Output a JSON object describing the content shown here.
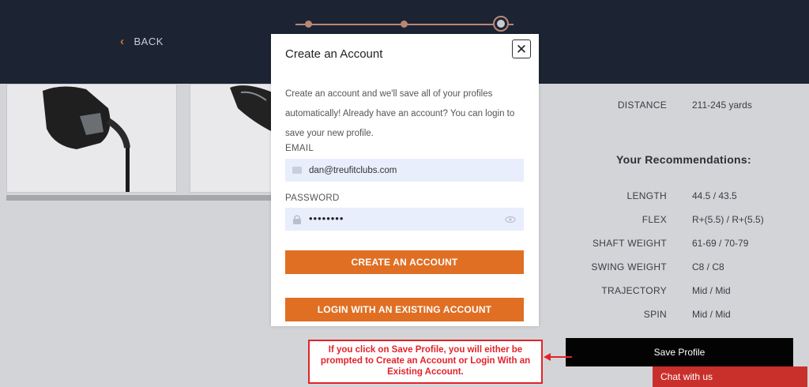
{
  "header": {
    "back_label": "BACK",
    "stepper_current": 3,
    "stepper_total": 3
  },
  "stats": {
    "distance_label": "DISTANCE",
    "distance_value": "211-245 yards",
    "recommendations_title": "Your Recommendations:",
    "rows": [
      {
        "label": "LENGTH",
        "value": "44.5 / 43.5"
      },
      {
        "label": "FLEX",
        "value": "R+(5.5) / R+(5.5)"
      },
      {
        "label": "SHAFT WEIGHT",
        "value": "61-69 / 70-79"
      },
      {
        "label": "SWING WEIGHT",
        "value": "C8 / C8"
      },
      {
        "label": "TRAJECTORY",
        "value": "Mid / Mid"
      },
      {
        "label": "SPIN",
        "value": "Mid / Mid"
      }
    ]
  },
  "save_profile_label": "Save Profile",
  "chat_label": "Chat with us",
  "modal": {
    "title": "Create an Account",
    "description": "Create an account and we'll save all of your profiles automatically! Already have an account? You can login to save your new profile.",
    "email_label": "EMAIL",
    "email_value": "dan@treufitclubs.com",
    "password_label": "PASSWORD",
    "password_value": "••••••••",
    "create_button": "CREATE AN ACCOUNT",
    "login_button": "LOGIN WITH AN EXISTING ACCOUNT",
    "close_symbol": "✕"
  },
  "annotation": {
    "text": "If you click on Save Profile, you will either be prompted to Create an Account or Login With an Existing Account."
  },
  "colors": {
    "accent": "#e06f23",
    "header_bg": "#1c2434",
    "annotation_red": "#e3232a",
    "chat_red": "#c9302c"
  },
  "icons": [
    "chevron-left-icon",
    "close-icon",
    "email-icon",
    "lock-icon",
    "eye-icon",
    "arrow-left-icon"
  ]
}
